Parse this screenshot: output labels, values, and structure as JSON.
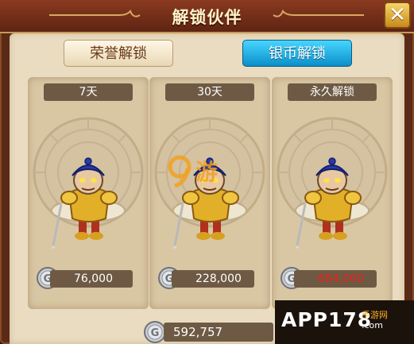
{
  "window": {
    "title": "解锁伙伴",
    "close_glyph": "✕"
  },
  "tabs": [
    {
      "label": "荣誉解锁",
      "active": false
    },
    {
      "label": "银币解锁",
      "active": true
    }
  ],
  "cards": [
    {
      "duration": "7天",
      "price": "76,000",
      "price_color": "#ffffff"
    },
    {
      "duration": "30天",
      "price": "228,000",
      "price_color": "#ffffff"
    },
    {
      "duration": "永久解锁",
      "price": "684,000",
      "price_color": "#e8201a"
    }
  ],
  "balance": {
    "value": "592,757"
  },
  "currency_icon": "silver-coin-icon",
  "watermark": {
    "logo_text": "9 游",
    "app_text": "APP178",
    "sub_text": "手游网",
    "url_text": ".com"
  },
  "colors": {
    "frame": "#5a2a16",
    "panel": "#eadcc0",
    "card": "#d9c7a4",
    "label_bg": "#6e5a44",
    "active_tab": "#1aa8e0",
    "price_red": "#e8201a"
  }
}
